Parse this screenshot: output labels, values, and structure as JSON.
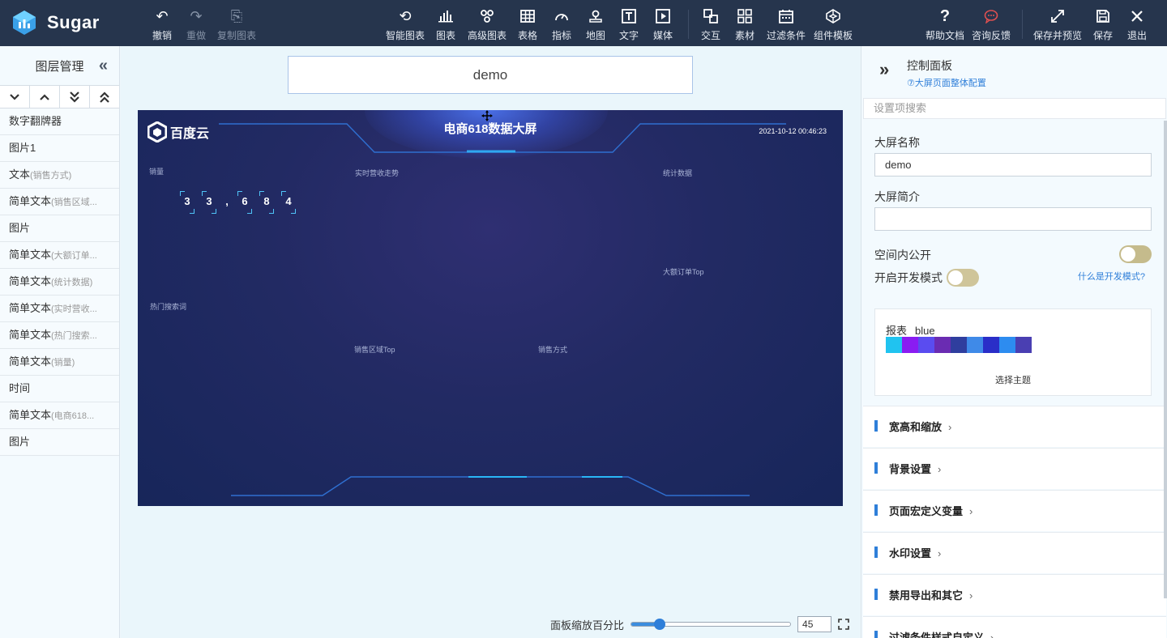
{
  "app": {
    "name": "Sugar"
  },
  "toolbar": {
    "left": [
      {
        "name": "undo",
        "label": "撤销",
        "icon": "undo-icon",
        "enabled": true
      },
      {
        "name": "redo",
        "label": "重做",
        "icon": "redo-icon",
        "enabled": false
      },
      {
        "name": "copy-chart",
        "label": "复制图表",
        "icon": "copy-icon",
        "enabled": false
      }
    ],
    "center": [
      {
        "name": "smart-chart",
        "label": "智能图表",
        "icon": "smart-chart-icon"
      },
      {
        "name": "chart",
        "label": "图表",
        "icon": "bar-chart-icon"
      },
      {
        "name": "advanced-chart",
        "label": "高级图表",
        "icon": "advanced-chart-icon"
      },
      {
        "name": "table",
        "label": "表格",
        "icon": "table-icon"
      },
      {
        "name": "indicator",
        "label": "指标",
        "icon": "gauge-icon"
      },
      {
        "name": "map",
        "label": "地图",
        "icon": "map-pin-icon"
      },
      {
        "name": "text",
        "label": "文字",
        "icon": "text-icon"
      },
      {
        "name": "media",
        "label": "媒体",
        "icon": "play-icon"
      },
      {
        "name": "interaction",
        "label": "交互",
        "icon": "interaction-icon"
      },
      {
        "name": "material",
        "label": "素材",
        "icon": "grid-icon"
      },
      {
        "name": "filter",
        "label": "过滤条件",
        "icon": "calendar-icon"
      },
      {
        "name": "component-template",
        "label": "组件模板",
        "icon": "codepen-icon"
      }
    ],
    "right": [
      {
        "name": "help-doc",
        "label": "帮助文档",
        "icon": "question-icon"
      },
      {
        "name": "feedback",
        "label": "咨询反馈",
        "icon": "chat-icon"
      },
      {
        "name": "save-preview",
        "label": "保存并预览",
        "icon": "expand-icon"
      },
      {
        "name": "save",
        "label": "保存",
        "icon": "save-icon"
      },
      {
        "name": "exit",
        "label": "退出",
        "icon": "close-icon"
      }
    ]
  },
  "layers": {
    "title": "图层管理",
    "items": [
      {
        "main": "数字翻牌器",
        "sub": ""
      },
      {
        "main": "图片1",
        "sub": ""
      },
      {
        "main": "文本",
        "sub": "(销售方式)"
      },
      {
        "main": "简单文本",
        "sub": "(销售区域..."
      },
      {
        "main": "图片",
        "sub": ""
      },
      {
        "main": "简单文本",
        "sub": "(大额订单..."
      },
      {
        "main": "简单文本",
        "sub": "(统计数据)"
      },
      {
        "main": "简单文本",
        "sub": "(实时营收..."
      },
      {
        "main": "简单文本",
        "sub": "(热门搜索..."
      },
      {
        "main": "简单文本",
        "sub": "(销量)"
      },
      {
        "main": "时间",
        "sub": ""
      },
      {
        "main": "简单文本",
        "sub": "(电商618..."
      },
      {
        "main": "图片",
        "sub": ""
      }
    ]
  },
  "canvas": {
    "screen_name": "demo",
    "screen": {
      "logo": "百度云",
      "title": "电商618数据大屏",
      "datetime": "2021-10-12 00:46:23",
      "labels": {
        "sales": "销量",
        "realtime_revenue": "实时营收走势",
        "stats": "统计数据",
        "big_orders": "大额订单Top",
        "hot_search": "热门搜索词",
        "region_top": "销售区域Top",
        "sales_method": "销售方式"
      },
      "flip_digits": [
        "3",
        "3",
        ",",
        "6",
        "8",
        "4"
      ]
    },
    "zoom": {
      "label": "面板缩放百分比",
      "value": "45",
      "fraction": 0.45
    }
  },
  "right_panel": {
    "title": "控制面板",
    "config_link": "⑦大屏页面整体配置",
    "search_placeholder": "设置项搜索",
    "name_label": "大屏名称",
    "name_value": "demo",
    "desc_label": "大屏简介",
    "desc_value": "",
    "public_label": "空间内公开",
    "dev_label": "开启开发模式",
    "dev_help": "什么是开发模式?",
    "theme": {
      "label": "报表",
      "name": "blue",
      "choose": "选择主题",
      "colors": [
        "#20c3f0",
        "#8a1cf2",
        "#5a4cf0",
        "#6a2cb2",
        "#2f3e9e",
        "#3f8ae8",
        "#2a2ec8",
        "#2d8cf0",
        "#4a3fb2"
      ]
    },
    "sections": [
      "宽高和缩放",
      "背景设置",
      "页面宏定义变量",
      "水印设置",
      "禁用导出和其它",
      "过滤条件样式自定义"
    ]
  }
}
